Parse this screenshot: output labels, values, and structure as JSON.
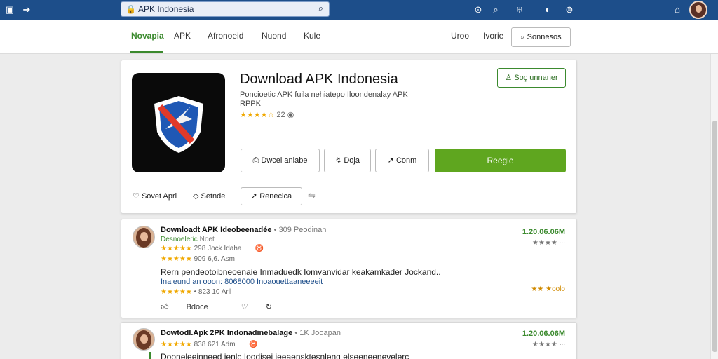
{
  "topbar": {
    "search_text": "APK Indonesia",
    "icons": [
      "square-icon",
      "arrow-right-icon",
      "lock-icon",
      "search-icon",
      "history-icon",
      "search-small-icon",
      "apk-icon",
      "globe-icon",
      "help-icon",
      "settings-icon"
    ]
  },
  "nav": {
    "items": [
      "Novapia",
      "APK",
      "Afronoeid",
      "Nuond",
      "Kule"
    ],
    "right_items": [
      "Uroo",
      "Ivorie"
    ],
    "button": "Sonnesos"
  },
  "app": {
    "title": "Download APK Indonesia",
    "description": "Poncioetic APK fuila nehiatepo Iloondenalay APK RPPK",
    "stars": "★★★★☆",
    "rating_count": "22",
    "subscribe": "Soç unnaner",
    "btn_download": "Dwcel anlabe",
    "btn_share": "Doja",
    "btn_connect": "Conm",
    "btn_primary": "Reegle",
    "save_label": "Sovet Aprl",
    "settings_label": "Setnde",
    "recent_label": "Renecica"
  },
  "comments": [
    {
      "title": "Downloadt APK Ideobeenadée",
      "title_meta": "• 309 Peodinan",
      "green_name": "Desnoeleric",
      "green_meta": "Noet",
      "stars1": "★★★★★",
      "line1": "298 Jock  Idaha",
      "stars2": "★★★★★",
      "line2": "909  6,6.  Asm",
      "body1": "Rern pendeotoibneoenaie Inmaduedk Iomvanvidar keakamkader Jockand..",
      "body2": "Inaieund an ooon: 8068000 Inoaouettaaneeeeit",
      "stars3": "★★★★★",
      "line3": "• 823  10  Arll",
      "price": "1.20.06.06M",
      "rating_r": "★★★★ ∙∙∙",
      "rating_y": "★★ ★oolo",
      "act_like": "Bdoce"
    },
    {
      "title": "Dowtodl.Apk 2PK Indonadinebalage",
      "title_meta": "• 1K Jooapan",
      "stars1": "★★★★★",
      "line1": "838  621  Adm",
      "body1": "Dooneleeinneed ienlc Ioodisei ieeaensktesnleng elseeneenevelerc",
      "price": "1.20.06.06M",
      "rating_r": "★★★★ ∙∙∙"
    }
  ],
  "colors": {
    "topbar": "#1d4e8a",
    "accent_green": "#5fa61f",
    "star": "#f0a800"
  }
}
